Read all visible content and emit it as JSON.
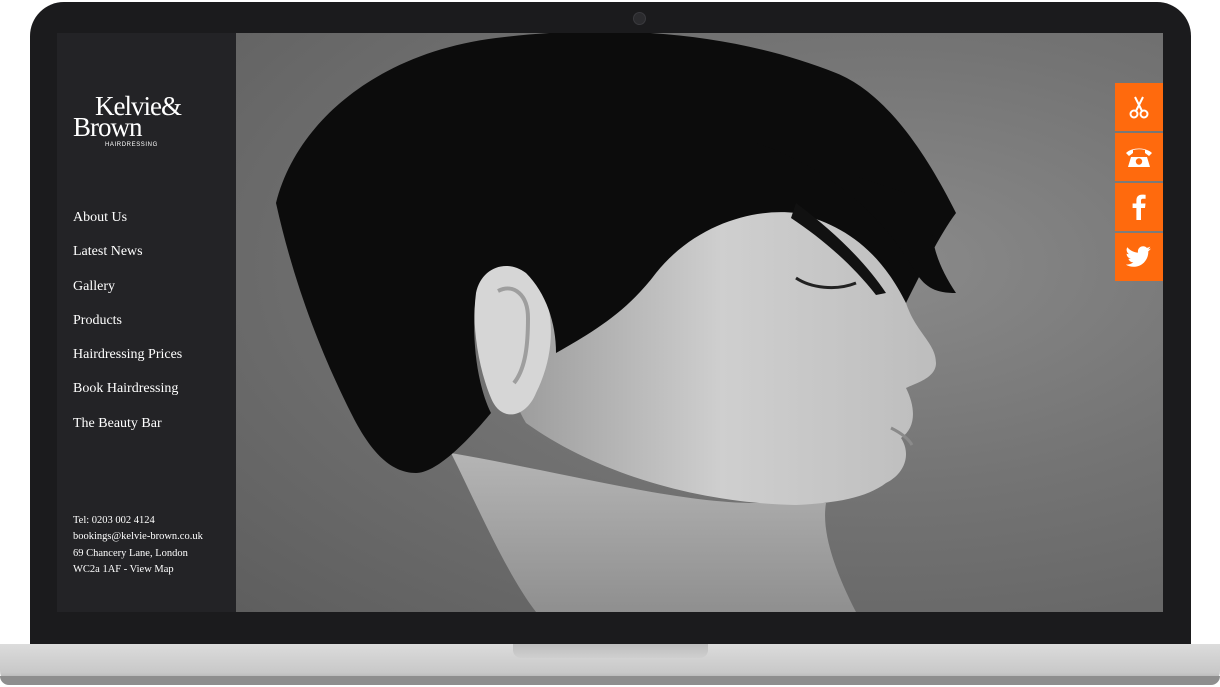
{
  "brand": {
    "logo_line1": "Kelvie&",
    "logo_line2": "Brown",
    "logo_sub": "HAIRDRESSING"
  },
  "nav": {
    "items": [
      {
        "label": "About Us"
      },
      {
        "label": "Latest News"
      },
      {
        "label": "Gallery"
      },
      {
        "label": "Products"
      },
      {
        "label": "Hairdressing Prices"
      },
      {
        "label": "Book Hairdressing"
      },
      {
        "label": "The Beauty Bar"
      }
    ]
  },
  "contact": {
    "phone": "Tel: 0203 002 4124",
    "email": "bookings@kelvie-brown.co.uk",
    "address_line1": "69 Chancery Lane, London",
    "address_line2": "WC2a 1AF - View Map"
  },
  "side_buttons": [
    {
      "icon": "scissors-icon"
    },
    {
      "icon": "telephone-icon"
    },
    {
      "icon": "facebook-icon"
    },
    {
      "icon": "twitter-icon"
    }
  ],
  "colors": {
    "accent": "#ff6a0d",
    "sidebar_bg": "#232326",
    "bezel": "#1b1b1d"
  }
}
